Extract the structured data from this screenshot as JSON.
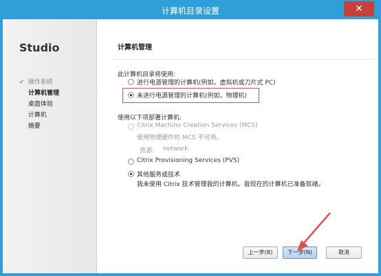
{
  "window": {
    "title": "计算机目录设置",
    "close_icon": "close-icon"
  },
  "sidebar": {
    "brand": "Studio",
    "items": [
      {
        "label": "操作系统",
        "state": "done"
      },
      {
        "label": "计算机管理",
        "state": "active"
      },
      {
        "label": "桌面体验",
        "state": "normal"
      },
      {
        "label": "计算机",
        "state": "normal"
      },
      {
        "label": "摘要",
        "state": "normal"
      }
    ]
  },
  "main": {
    "title": "计算机管理",
    "section1": {
      "heading": "此计算机目录将使用:",
      "options": [
        {
          "label": "进行电源管理的计算机(例如，虚拟机或刀片式 PC)",
          "selected": false
        },
        {
          "label": "未进行电源管理的计算机(例如，物理机)",
          "selected": true
        }
      ]
    },
    "section2": {
      "heading": "使用以下项部署计算机:",
      "options": [
        {
          "label": "Citrix Machine Creation Services (MCS)",
          "enabled": false,
          "description": "使用物理硬件时 MCS 不可用。",
          "resource_label": "资源:",
          "resource_value": "network"
        },
        {
          "label": "Citrix Provisioning Services (PVS)",
          "enabled": true
        },
        {
          "label": "其他服务或技术",
          "enabled": true,
          "selected": true,
          "description": "我未使用 Citrix 技术管理我的计算机。我现在的计算机已准备就绪。"
        }
      ]
    }
  },
  "footer": {
    "back_label": "上一步(B)",
    "next_label": "下一步(N)",
    "cancel_label": "取消"
  },
  "colors": {
    "titlebar_bg": "#2f9fd9",
    "highlight_border": "#e34e4e",
    "primary_button_border": "#5f91c9"
  }
}
